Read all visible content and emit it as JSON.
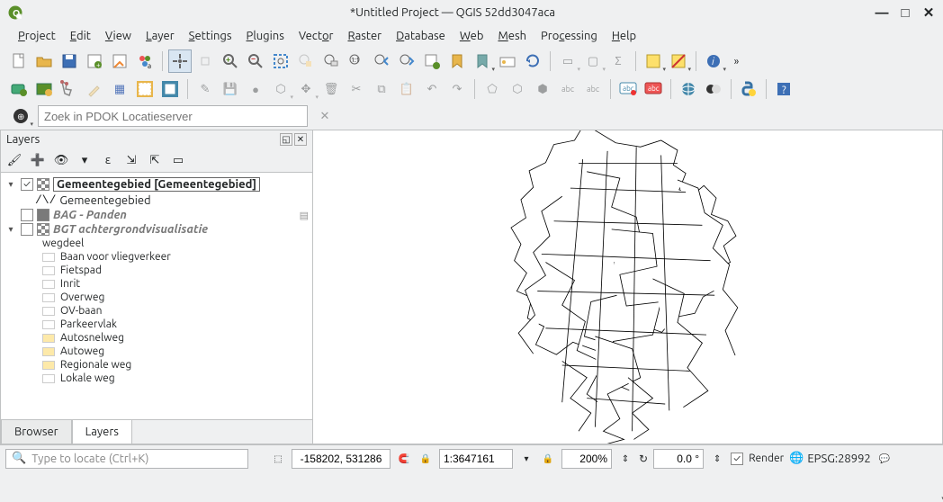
{
  "window": {
    "title": "*Untitled Project — QGIS 52dd3047aca"
  },
  "window_controls": {
    "minimize": "—",
    "maximize": "□",
    "close": "✕"
  },
  "menu": {
    "project": "Project",
    "edit": "Edit",
    "view": "View",
    "layer": "Layer",
    "settings": "Settings",
    "plugins": "Plugins",
    "vector": "Vector",
    "raster": "Raster",
    "database": "Database",
    "web": "Web",
    "mesh": "Mesh",
    "processing": "Processing",
    "help": "Help"
  },
  "icons": {
    "overflow": "»"
  },
  "search": {
    "placeholder": "Zoek in PDOK Locatieserver"
  },
  "panel": {
    "title": "Layers",
    "tabs": {
      "browser": "Browser",
      "layers": "Layers"
    }
  },
  "layers": {
    "root1": {
      "label": "Gemeentegebied [Gemeentegebied]",
      "checked": true
    },
    "root1_child": {
      "label": "Gemeentegebied",
      "symbol": "∧∨"
    },
    "bag": {
      "label": "BAG - Panden",
      "checked": false
    },
    "bgt": {
      "label": "BGT achtergrondvisualisatie",
      "checked": false
    },
    "bgt_group": "wegdeel",
    "bgt_items": [
      {
        "label": "Baan voor vliegverkeer",
        "sw": "sw-none"
      },
      {
        "label": "Fietspad",
        "sw": "sw-none"
      },
      {
        "label": "Inrit",
        "sw": "sw-none"
      },
      {
        "label": "Overweg",
        "sw": "sw-none"
      },
      {
        "label": "OV-baan",
        "sw": "sw-none"
      },
      {
        "label": "Parkeervlak",
        "sw": "sw-none"
      },
      {
        "label": "Autosnelweg",
        "sw": "sw-yellow"
      },
      {
        "label": "Autoweg",
        "sw": "sw-yellow"
      },
      {
        "label": "Regionale weg",
        "sw": "sw-yellow"
      },
      {
        "label": "Lokale weg",
        "sw": "sw-none"
      }
    ]
  },
  "status": {
    "locate_placeholder": "Type to locate (Ctrl+K)",
    "coordinate": "-158202, 531286",
    "scale_value": "1:3647161",
    "magnifier": "200%",
    "rotation": "0.0 °",
    "render_label": "Render",
    "crs": "EPSG:28992"
  }
}
